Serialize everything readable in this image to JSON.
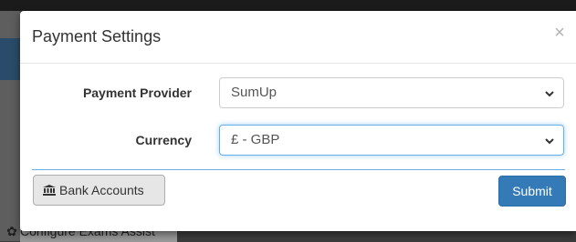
{
  "background": {
    "bottom_text": "Configure Exams Assist"
  },
  "modal": {
    "title": "Payment Settings",
    "close_glyph": "×",
    "fields": {
      "provider": {
        "label": "Payment Provider",
        "value": "SumUp"
      },
      "currency": {
        "label": "Currency",
        "value": "£ - GBP"
      }
    },
    "buttons": {
      "bank_accounts": "Bank Accounts",
      "submit": "Submit"
    }
  },
  "icons": {
    "bank": "bank-icon",
    "chevron": "chevron-down-icon",
    "close": "close-icon",
    "gear": "gear-icon"
  },
  "colors": {
    "primary": "#337ab7",
    "focus": "#66afe9"
  }
}
